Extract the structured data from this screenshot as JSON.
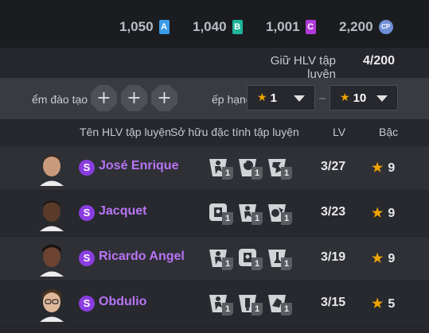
{
  "currencies": [
    {
      "amount": "1,050",
      "tag": "A",
      "color": "#3b9be9"
    },
    {
      "amount": "1,040",
      "tag": "B",
      "color": "#1fb59a"
    },
    {
      "amount": "1,001",
      "tag": "C",
      "color": "#b03ad8"
    },
    {
      "amount": "2,200",
      "tag": "CP",
      "color": "#6f8fd6"
    }
  ],
  "holding": {
    "label": "Giữ HLV tập luyện",
    "count": "4/200"
  },
  "filters": {
    "slot_label": "ểm đào tạo",
    "slot_buttons": [
      "+",
      "+",
      "+"
    ],
    "rank_label": "ếp hạng",
    "rank_from": "1",
    "separator": "~",
    "rank_to": "10"
  },
  "columns": {
    "name": "Tên HLV tập luyện",
    "traits": "Sở hữu đặc tính tập luyện",
    "lv": "LV",
    "grade": "Bậc"
  },
  "rows": [
    {
      "badge": "S",
      "name": "José Enrique",
      "lv": "3/27",
      "grade": "9",
      "traits": [
        {
          "icon": "dribble-trait-icon",
          "level": "1"
        },
        {
          "icon": "heading-trait-icon",
          "level": "1"
        },
        {
          "icon": "sprint-trait-icon",
          "level": "1"
        }
      ]
    },
    {
      "badge": "S",
      "name": "Jacquet",
      "lv": "3/23",
      "grade": "9",
      "traits": [
        {
          "icon": "block-trait-icon",
          "level": "1"
        },
        {
          "icon": "dribble-trait-icon",
          "level": "1"
        },
        {
          "icon": "ball-control-trait-icon",
          "level": "1"
        }
      ]
    },
    {
      "badge": "S",
      "name": "Ricardo Angel",
      "lv": "3/19",
      "grade": "9",
      "traits": [
        {
          "icon": "dribble-trait-icon",
          "level": "1"
        },
        {
          "icon": "block-trait-icon",
          "level": "1"
        },
        {
          "icon": "jump-trait-icon",
          "level": "1"
        }
      ]
    },
    {
      "badge": "S",
      "name": "Obdulio",
      "lv": "3/15",
      "grade": "5",
      "traits": [
        {
          "icon": "dribble-trait-icon",
          "level": "1"
        },
        {
          "icon": "balance-trait-icon",
          "level": "1"
        },
        {
          "icon": "tackle-trait-icon",
          "level": "1"
        }
      ]
    }
  ]
}
